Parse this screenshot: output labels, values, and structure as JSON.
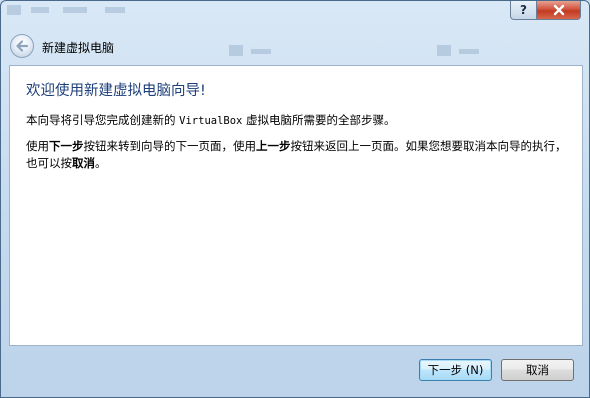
{
  "window": {
    "help_glyph": "?",
    "icons": {
      "help": "help-icon",
      "close": "close-icon",
      "back": "back-arrow-icon"
    }
  },
  "wizard": {
    "title": "新建虚拟电脑",
    "heading": "欢迎使用新建虚拟电脑向导!",
    "intro": {
      "before": "本向导将引导您完成创建新的 ",
      "product": "VirtualBox",
      "after": " 虚拟电脑所需要的全部步骤。"
    },
    "instructions": {
      "t1": "使用",
      "next_term": "下一步",
      "t2": "按钮来转到向导的下一页面，使用",
      "back_term": "上一步",
      "t3": "按钮来返回上一页面。如果您想要取消本向导的执行，也可以按",
      "cancel_term": "取消",
      "t4": "。"
    }
  },
  "buttons": {
    "next": "下一步 (N)",
    "cancel": "取消"
  }
}
